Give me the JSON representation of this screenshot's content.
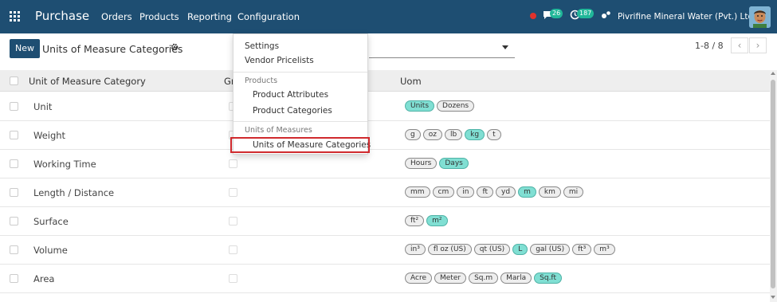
{
  "navbar": {
    "app_title": "Purchase",
    "menus": [
      "Orders",
      "Products",
      "Reporting",
      "Configuration"
    ],
    "messages_count": "26",
    "activities_count": "187",
    "company": "Pivrifine Mineral Water (Pvt.) Ltd."
  },
  "control_panel": {
    "new_label": "New",
    "title": "Units of Measure Categories",
    "pager": "1-8 / 8",
    "prev_icon": "‹",
    "next_icon": "›"
  },
  "table": {
    "columns": [
      "Unit of Measure Category",
      "Gr",
      "Uom"
    ],
    "rows": [
      {
        "name": "Unit",
        "uoms": [
          "Units",
          "Dozens"
        ],
        "ref": "Units"
      },
      {
        "name": "Weight",
        "uoms": [
          "g",
          "oz",
          "lb",
          "kg",
          "t"
        ],
        "ref": "kg"
      },
      {
        "name": "Working Time",
        "uoms": [
          "Hours",
          "Days"
        ],
        "ref": "Days"
      },
      {
        "name": "Length / Distance",
        "uoms": [
          "mm",
          "cm",
          "in",
          "ft",
          "yd",
          "m",
          "km",
          "mi"
        ],
        "ref": "m"
      },
      {
        "name": "Surface",
        "uoms": [
          "ft²",
          "m²"
        ],
        "ref": "m²"
      },
      {
        "name": "Volume",
        "uoms": [
          "in³",
          "fl oz (US)",
          "qt (US)",
          "L",
          "gal (US)",
          "ft³",
          "m³"
        ],
        "ref": "L"
      },
      {
        "name": "Area",
        "uoms": [
          "Acre",
          "Meter",
          "Sq.m",
          "Marla",
          "Sq.ft"
        ],
        "ref": "Sq.ft"
      }
    ]
  },
  "dropdown": {
    "settings": "Settings",
    "vendor_pricelists": "Vendor Pricelists",
    "products_header": "Products",
    "product_attributes": "Product Attributes",
    "product_categories": "Product Categories",
    "uom_header": "Units of Measures",
    "uom_categories": "Units of Measure Categories"
  },
  "colors": {
    "navbar": "#1e4e72",
    "highlight_tag": "#80dfd3",
    "selection_outline": "#d02a2e"
  }
}
